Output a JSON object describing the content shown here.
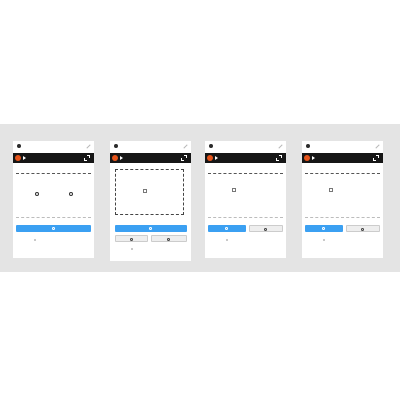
{
  "colors": {
    "background_band": "#e4e4e4",
    "panel": "#ffffff",
    "dark_bar": "#161616",
    "brand_dot": "#e6541b",
    "primary_button": "#3ba0f2",
    "link": "#3ba0f2"
  },
  "icons": {
    "avatar": "avatar-icon",
    "edit": "pencil-icon",
    "brand": "brand-dot-icon",
    "play": "play-icon",
    "expand": "expand-icon",
    "refresh": "refresh-icon",
    "upload": "upload-icon"
  },
  "panels": [
    {
      "title": "",
      "bar_label": "",
      "canvas_text": "",
      "primary_button": "",
      "footer": {
        "left": "",
        "links": [
          "",
          "",
          ""
        ]
      }
    },
    {
      "title": "",
      "bar_label": "",
      "drop_text_line1": "",
      "drop_text_line2": "",
      "primary_button": "",
      "secondary_button_a": "",
      "secondary_button_b": "",
      "footer": {
        "left": "",
        "links": [
          "",
          "",
          ""
        ]
      }
    },
    {
      "title": "",
      "bar_label": "",
      "drop_text_line1": "",
      "drop_text_line2": "",
      "primary_button": "",
      "secondary_button": "",
      "footer": {
        "left": "",
        "links": [
          "",
          "",
          ""
        ]
      }
    },
    {
      "title": "",
      "bar_label": "",
      "drop_text_line1": "",
      "drop_text_line2": "",
      "primary_button": "",
      "secondary_button": "",
      "footer": {
        "left": "",
        "links": [
          "",
          "",
          ""
        ]
      }
    }
  ]
}
